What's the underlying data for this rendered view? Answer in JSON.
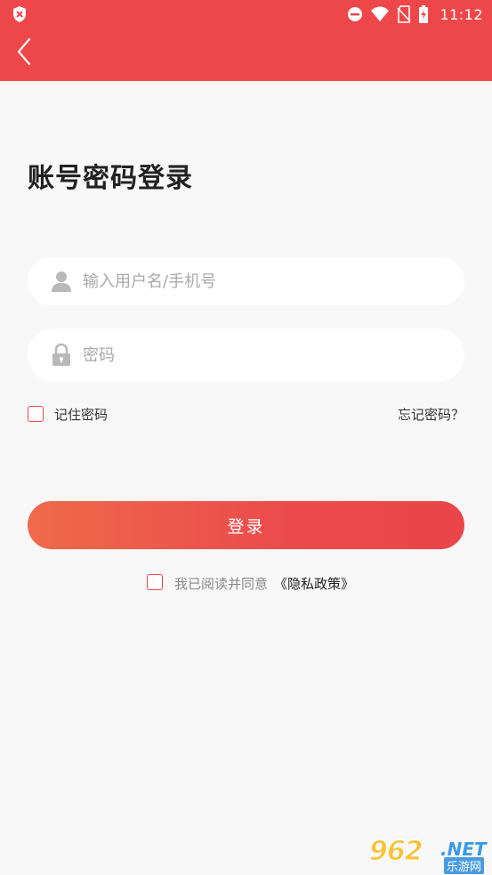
{
  "status_bar": {
    "time": "11:12"
  },
  "header": {
    "back_icon": "chevron-left-icon",
    "background_color": "#ee474a"
  },
  "page": {
    "title": "账号密码登录"
  },
  "form": {
    "username": {
      "placeholder": "输入用户名/手机号",
      "value": "",
      "icon": "user-icon"
    },
    "password": {
      "placeholder": "密码",
      "value": "",
      "icon": "lock-icon"
    },
    "remember_label": "记住密码",
    "forgot_label": "忘记密码？",
    "login_label": "登录"
  },
  "agreement": {
    "text": "我已阅读并同意",
    "policy_link": "《隐私政策》"
  },
  "watermark": {
    "number": "962",
    "domain": ".NET",
    "sub": "乐游网"
  },
  "colors": {
    "accent": "#ee474a",
    "button_gradient_start": "#ef6a4a",
    "button_gradient_end": "#ea4549"
  }
}
